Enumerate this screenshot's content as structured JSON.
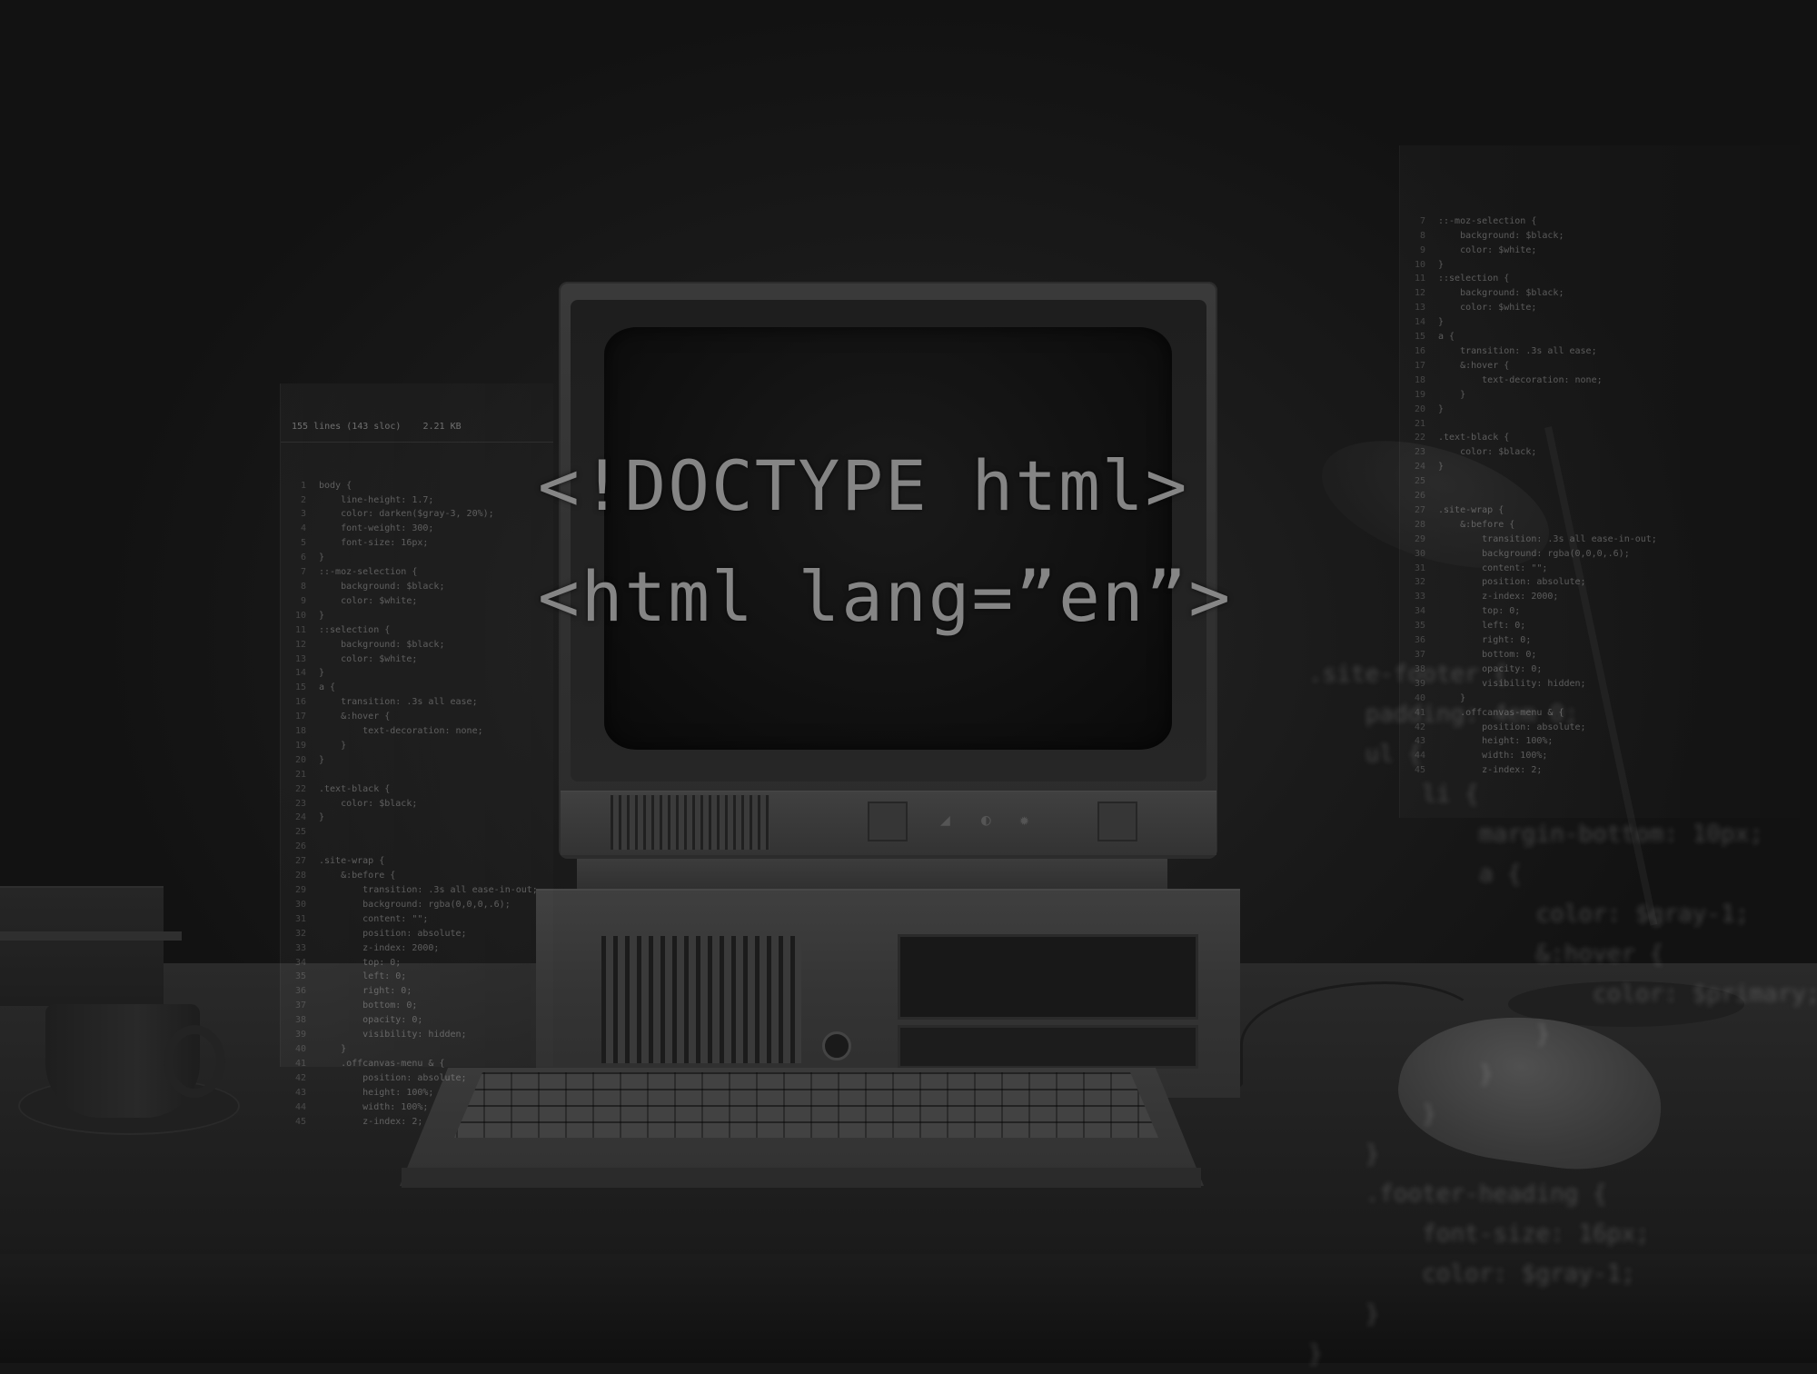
{
  "headline": {
    "line1": "<!DOCTYPE html>",
    "line2": "<html lang=”en”>"
  },
  "editor": {
    "file_info": "155 lines (143 sloc)    2.21 KB",
    "lines": [
      {
        "n": "1",
        "t": "body {"
      },
      {
        "n": "2",
        "t": "    line-height: 1.7;"
      },
      {
        "n": "3",
        "t": "    color: darken($gray-3, 20%);"
      },
      {
        "n": "4",
        "t": "    font-weight: 300;"
      },
      {
        "n": "5",
        "t": "    font-size: 16px;"
      },
      {
        "n": "6",
        "t": "}"
      },
      {
        "n": "7",
        "t": "::-moz-selection {"
      },
      {
        "n": "8",
        "t": "    background: $black;"
      },
      {
        "n": "9",
        "t": "    color: $white;"
      },
      {
        "n": "10",
        "t": "}"
      },
      {
        "n": "11",
        "t": "::selection {"
      },
      {
        "n": "12",
        "t": "    background: $black;"
      },
      {
        "n": "13",
        "t": "    color: $white;"
      },
      {
        "n": "14",
        "t": "}"
      },
      {
        "n": "15",
        "t": "a {"
      },
      {
        "n": "16",
        "t": "    transition: .3s all ease;"
      },
      {
        "n": "17",
        "t": "    &:hover {"
      },
      {
        "n": "18",
        "t": "        text-decoration: none;"
      },
      {
        "n": "19",
        "t": "    }"
      },
      {
        "n": "20",
        "t": "}"
      },
      {
        "n": "21",
        "t": ""
      },
      {
        "n": "22",
        "t": ".text-black {"
      },
      {
        "n": "23",
        "t": "    color: $black;"
      },
      {
        "n": "24",
        "t": "}"
      },
      {
        "n": "25",
        "t": ""
      },
      {
        "n": "26",
        "t": ""
      },
      {
        "n": "27",
        "t": ".site-wrap {"
      },
      {
        "n": "28",
        "t": "    &:before {"
      },
      {
        "n": "29",
        "t": "        transition: .3s all ease-in-out;"
      },
      {
        "n": "30",
        "t": "        background: rgba(0,0,0,.6);"
      },
      {
        "n": "31",
        "t": "        content: \"\";"
      },
      {
        "n": "32",
        "t": "        position: absolute;"
      },
      {
        "n": "33",
        "t": "        z-index: 2000;"
      },
      {
        "n": "34",
        "t": "        top: 0;"
      },
      {
        "n": "35",
        "t": "        left: 0;"
      },
      {
        "n": "36",
        "t": "        right: 0;"
      },
      {
        "n": "37",
        "t": "        bottom: 0;"
      },
      {
        "n": "38",
        "t": "        opacity: 0;"
      },
      {
        "n": "39",
        "t": "        visibility: hidden;"
      },
      {
        "n": "40",
        "t": "    }"
      },
      {
        "n": "41",
        "t": "    .offcanvas-menu & {"
      },
      {
        "n": "42",
        "t": "        position: absolute;"
      },
      {
        "n": "43",
        "t": "        height: 100%;"
      },
      {
        "n": "44",
        "t": "        width: 100%;"
      },
      {
        "n": "45",
        "t": "        z-index: 2;"
      }
    ]
  },
  "blurred_code": [
    ".site-footer {",
    "    padding: 4em 0;",
    "    ul {",
    "        li {",
    "            margin-bottom: 10px;",
    "            a {",
    "                color: $gray-1;",
    "                &:hover {",
    "                    color: $primary;",
    "                }",
    "            }",
    "        }",
    "    }",
    "    .footer-heading {",
    "        font-size: 16px;",
    "        color: $gray-1;",
    "    }",
    "}"
  ]
}
